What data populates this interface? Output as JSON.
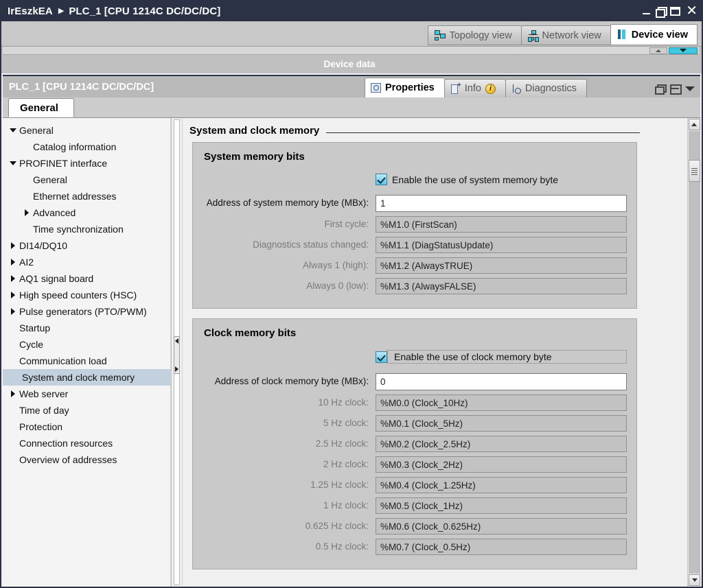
{
  "window": {
    "breadcrumb_root": "IrEszkEA",
    "breadcrumb_sep": "▶",
    "breadcrumb_leaf": "PLC_1 [CPU 1214C DC/DC/DC]",
    "buttons": {
      "minimize": "Minimize",
      "restore": "Restore",
      "maximize": "Maximize",
      "close": "✕"
    }
  },
  "view_tabs": [
    {
      "label": "Topology view",
      "icon": "topology-icon",
      "active": false
    },
    {
      "label": "Network view",
      "icon": "network-icon",
      "active": false
    },
    {
      "label": "Device view",
      "icon": "device-icon",
      "active": true
    }
  ],
  "device_strip": {
    "label": "Device data"
  },
  "properties_bar": {
    "title": "PLC_1 [CPU 1214C DC/DC/DC]",
    "tabs": [
      {
        "label": "Properties",
        "icon": "properties-icon",
        "active": true,
        "badge": ""
      },
      {
        "label": "Info",
        "icon": "info-icon",
        "active": false,
        "badge": "i"
      },
      {
        "label": "Diagnostics",
        "icon": "diagnostics-icon",
        "active": false,
        "badge": ""
      }
    ]
  },
  "general_tab": {
    "label": "General"
  },
  "sidebar": {
    "items": [
      {
        "label": "General",
        "indent": 0,
        "twisty": "down",
        "selected": false
      },
      {
        "label": "Catalog information",
        "indent": 1,
        "twisty": "none",
        "selected": false
      },
      {
        "label": "PROFINET interface",
        "indent": 0,
        "twisty": "down",
        "selected": false
      },
      {
        "label": "General",
        "indent": 1,
        "twisty": "none",
        "selected": false
      },
      {
        "label": "Ethernet addresses",
        "indent": 1,
        "twisty": "none",
        "selected": false
      },
      {
        "label": "Advanced",
        "indent": 1,
        "twisty": "right",
        "selected": false
      },
      {
        "label": "Time synchronization",
        "indent": 1,
        "twisty": "none",
        "selected": false
      },
      {
        "label": "DI14/DQ10",
        "indent": 0,
        "twisty": "right",
        "selected": false
      },
      {
        "label": "AI2",
        "indent": 0,
        "twisty": "right",
        "selected": false
      },
      {
        "label": "AQ1 signal board",
        "indent": 0,
        "twisty": "right",
        "selected": false
      },
      {
        "label": "High speed counters (HSC)",
        "indent": 0,
        "twisty": "right",
        "selected": false
      },
      {
        "label": "Pulse generators (PTO/PWM)",
        "indent": 0,
        "twisty": "right",
        "selected": false
      },
      {
        "label": "Startup",
        "indent": 0,
        "twisty": "none",
        "selected": false
      },
      {
        "label": "Cycle",
        "indent": 0,
        "twisty": "none",
        "selected": false
      },
      {
        "label": "Communication load",
        "indent": 0,
        "twisty": "none",
        "selected": false
      },
      {
        "label": "System and clock memory",
        "indent": 0,
        "twisty": "none",
        "selected": true
      },
      {
        "label": "Web server",
        "indent": 0,
        "twisty": "right",
        "selected": false
      },
      {
        "label": "Time of day",
        "indent": 0,
        "twisty": "none",
        "selected": false
      },
      {
        "label": "Protection",
        "indent": 0,
        "twisty": "none",
        "selected": false
      },
      {
        "label": "Connection resources",
        "indent": 0,
        "twisty": "none",
        "selected": false
      },
      {
        "label": "Overview of addresses",
        "indent": 0,
        "twisty": "none",
        "selected": false
      }
    ]
  },
  "content": {
    "page_title": "System and clock memory",
    "system_memory": {
      "group_title": "System memory bits",
      "enable_label": "Enable the use of system memory byte",
      "enable_checked": true,
      "address_label": "Address of system memory byte (MBx):",
      "address_value": "1",
      "rows": [
        {
          "label": "First cycle:",
          "value": "%M1.0 (FirstScan)"
        },
        {
          "label": "Diagnostics status changed:",
          "value": "%M1.1 (DiagStatusUpdate)"
        },
        {
          "label": "Always 1 (high):",
          "value": "%M1.2 (AlwaysTRUE)"
        },
        {
          "label": "Always 0 (low):",
          "value": "%M1.3 (AlwaysFALSE)"
        }
      ]
    },
    "clock_memory": {
      "group_title": "Clock memory bits",
      "enable_label": "Enable the use of clock memory byte",
      "enable_checked": true,
      "address_label": "Address of clock memory byte (MBx):",
      "address_value": "0",
      "rows": [
        {
          "label": "10 Hz clock:",
          "value": "%M0.0 (Clock_10Hz)"
        },
        {
          "label": "5 Hz clock:",
          "value": "%M0.1 (Clock_5Hz)"
        },
        {
          "label": "2.5 Hz clock:",
          "value": "%M0.2 (Clock_2.5Hz)"
        },
        {
          "label": "2 Hz clock:",
          "value": "%M0.3 (Clock_2Hz)"
        },
        {
          "label": "1.25 Hz clock:",
          "value": "%M0.4 (Clock_1.25Hz)"
        },
        {
          "label": "1 Hz clock:",
          "value": "%M0.5 (Clock_1Hz)"
        },
        {
          "label": "0.625 Hz clock:",
          "value": "%M0.6 (Clock_0.625Hz)"
        },
        {
          "label": "0.5 Hz clock:",
          "value": "%M0.7 (Clock_0.5Hz)"
        }
      ]
    }
  },
  "colors": {
    "titlebar": "#2b3245",
    "accent_cyan": "#3ec8e0",
    "selection": "#c3d0dd",
    "group_bg": "#c9c9c9",
    "badge_yellow": "#e8a800"
  }
}
